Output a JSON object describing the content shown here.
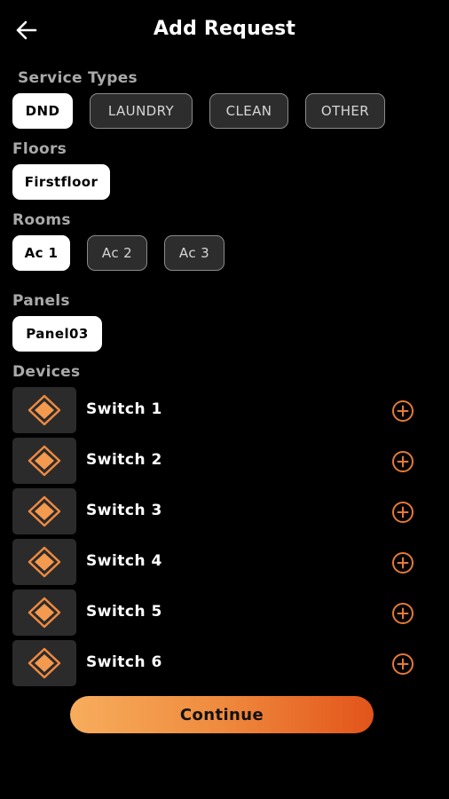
{
  "header": {
    "title": "Add Request",
    "back_icon": "arrow-left-icon"
  },
  "service_types": {
    "label": "Service Types",
    "options": [
      {
        "label": "DND",
        "selected": true
      },
      {
        "label": "LAUNDRY",
        "selected": false
      },
      {
        "label": "CLEAN",
        "selected": false
      },
      {
        "label": "OTHER",
        "selected": false
      }
    ]
  },
  "floors": {
    "label": "Floors",
    "options": [
      {
        "label": "Firstfloor",
        "selected": true
      }
    ]
  },
  "rooms": {
    "label": "Rooms",
    "options": [
      {
        "label": "Ac 1",
        "selected": true
      },
      {
        "label": "Ac 2",
        "selected": false
      },
      {
        "label": "Ac 3",
        "selected": false
      }
    ]
  },
  "panels": {
    "label": "Panels",
    "options": [
      {
        "label": "Panel03",
        "selected": true
      }
    ]
  },
  "devices": {
    "label": "Devices",
    "items": [
      {
        "label": "Switch 1",
        "icon": "diamond-switch-icon",
        "action_icon": "plus-circle-icon"
      },
      {
        "label": "Switch 2",
        "icon": "diamond-switch-icon",
        "action_icon": "plus-circle-icon"
      },
      {
        "label": "Switch 3",
        "icon": "diamond-switch-icon",
        "action_icon": "plus-circle-icon"
      },
      {
        "label": "Switch 4",
        "icon": "diamond-switch-icon",
        "action_icon": "plus-circle-icon"
      },
      {
        "label": "Switch 5",
        "icon": "diamond-switch-icon",
        "action_icon": "plus-circle-icon"
      },
      {
        "label": "Switch 6",
        "icon": "diamond-switch-icon",
        "action_icon": "plus-circle-icon"
      }
    ]
  },
  "continue_label": "Continue",
  "colors": {
    "background": "#000000",
    "accent": "#ef8a3e",
    "accent_light": "#f7ad5c",
    "accent_dark": "#e2541a",
    "chip_selected_bg": "#ffffff",
    "chip_unselected_bg": "#2d2d2d",
    "section_label": "#a9a9a9"
  }
}
